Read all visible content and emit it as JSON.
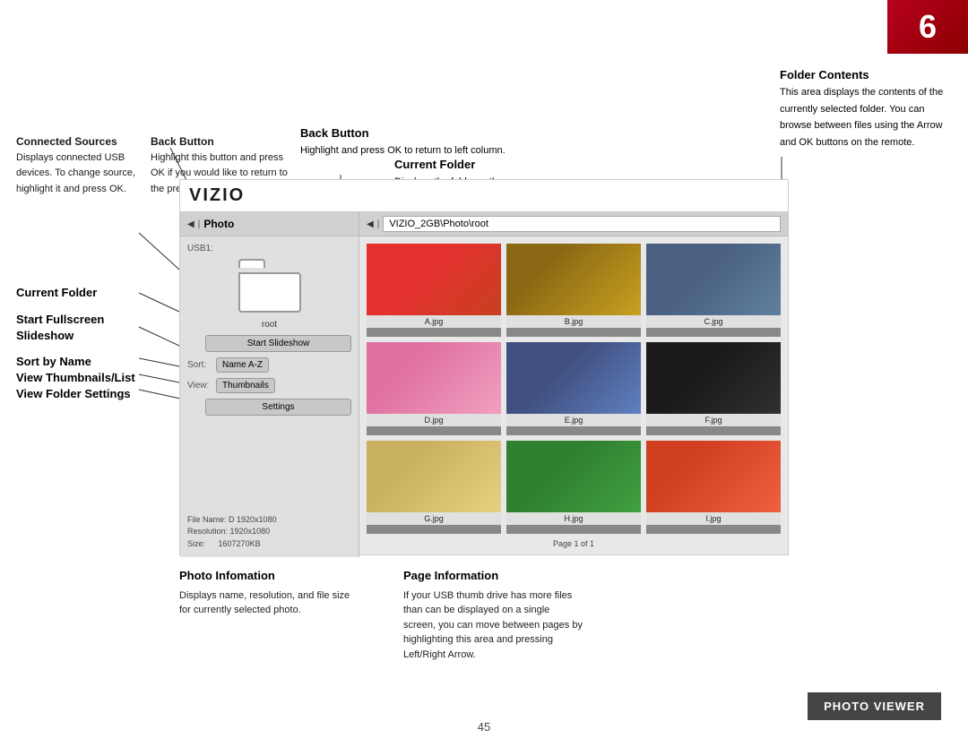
{
  "page": {
    "number": "6",
    "page_number_bottom": "45",
    "badge_label": "PHOTO VIEWER"
  },
  "vizio": {
    "logo": "VIZIO"
  },
  "nav": {
    "left_label": "Photo",
    "path_label": "VIZIO_2GB\\Photo\\root",
    "usb_label": "USB1:"
  },
  "folder": {
    "label": "root"
  },
  "buttons": {
    "slideshow": "Start Slideshow",
    "sort_label": "Sort:",
    "sort_value": "Name A-Z",
    "view_label": "View:",
    "view_value": "Thumbnails",
    "settings": "Settings"
  },
  "file_info": {
    "name_label": "File Name: D",
    "name_value": "1920x1080",
    "resolution_label": "Resolution:",
    "resolution_value": "1920x1080",
    "size_label": "Size:",
    "size_value": "1607270KB"
  },
  "photos": [
    {
      "id": "a",
      "caption": "A.jpg"
    },
    {
      "id": "b",
      "caption": "B.jpg"
    },
    {
      "id": "c",
      "caption": "C.jpg"
    },
    {
      "id": "d",
      "caption": "D.jpg"
    },
    {
      "id": "e",
      "caption": "E.jpg"
    },
    {
      "id": "f",
      "caption": "F.jpg"
    },
    {
      "id": "g",
      "caption": "G.jpg"
    },
    {
      "id": "h",
      "caption": "H.jpg"
    },
    {
      "id": "i",
      "caption": "I.jpg"
    }
  ],
  "page_info": "Page 1 of 1",
  "annotations": {
    "connected_sources": {
      "title": "Connected Sources",
      "text": "Displays connected USB devices. To change source, highlight it and press OK."
    },
    "back_button_left": {
      "title": "Back Button",
      "text": "Highlight this button and press OK if you would like to return to the previous screen."
    },
    "back_button_top": {
      "title": "Back Button",
      "text": "Highlight and press OK to return to left column."
    },
    "current_folder_label": "Current Folder",
    "current_folder_desc": "Displays the folder path.",
    "start_fullscreen_slideshow": "Start Fullscreen Slideshow",
    "sort_by_name": "Sort by Name",
    "view_thumbnails_list": "View Thumbnails/List",
    "view_folder_settings": "View Folder Settings",
    "photo_information": {
      "title": "Photo Infomation",
      "text": "Displays name, resolution, and file size for currently selected photo."
    },
    "page_information": {
      "title": "Page Information",
      "text": "If your USB thumb drive has more files than can be displayed on a single screen, you can move between pages by highlighting this area and pressing Left/Right Arrow."
    },
    "folder_contents": {
      "title": "Folder Contents",
      "text": "This area displays the contents of the currently selected folder. You can browse between files using the Arrow and OK buttons on the remote."
    }
  }
}
